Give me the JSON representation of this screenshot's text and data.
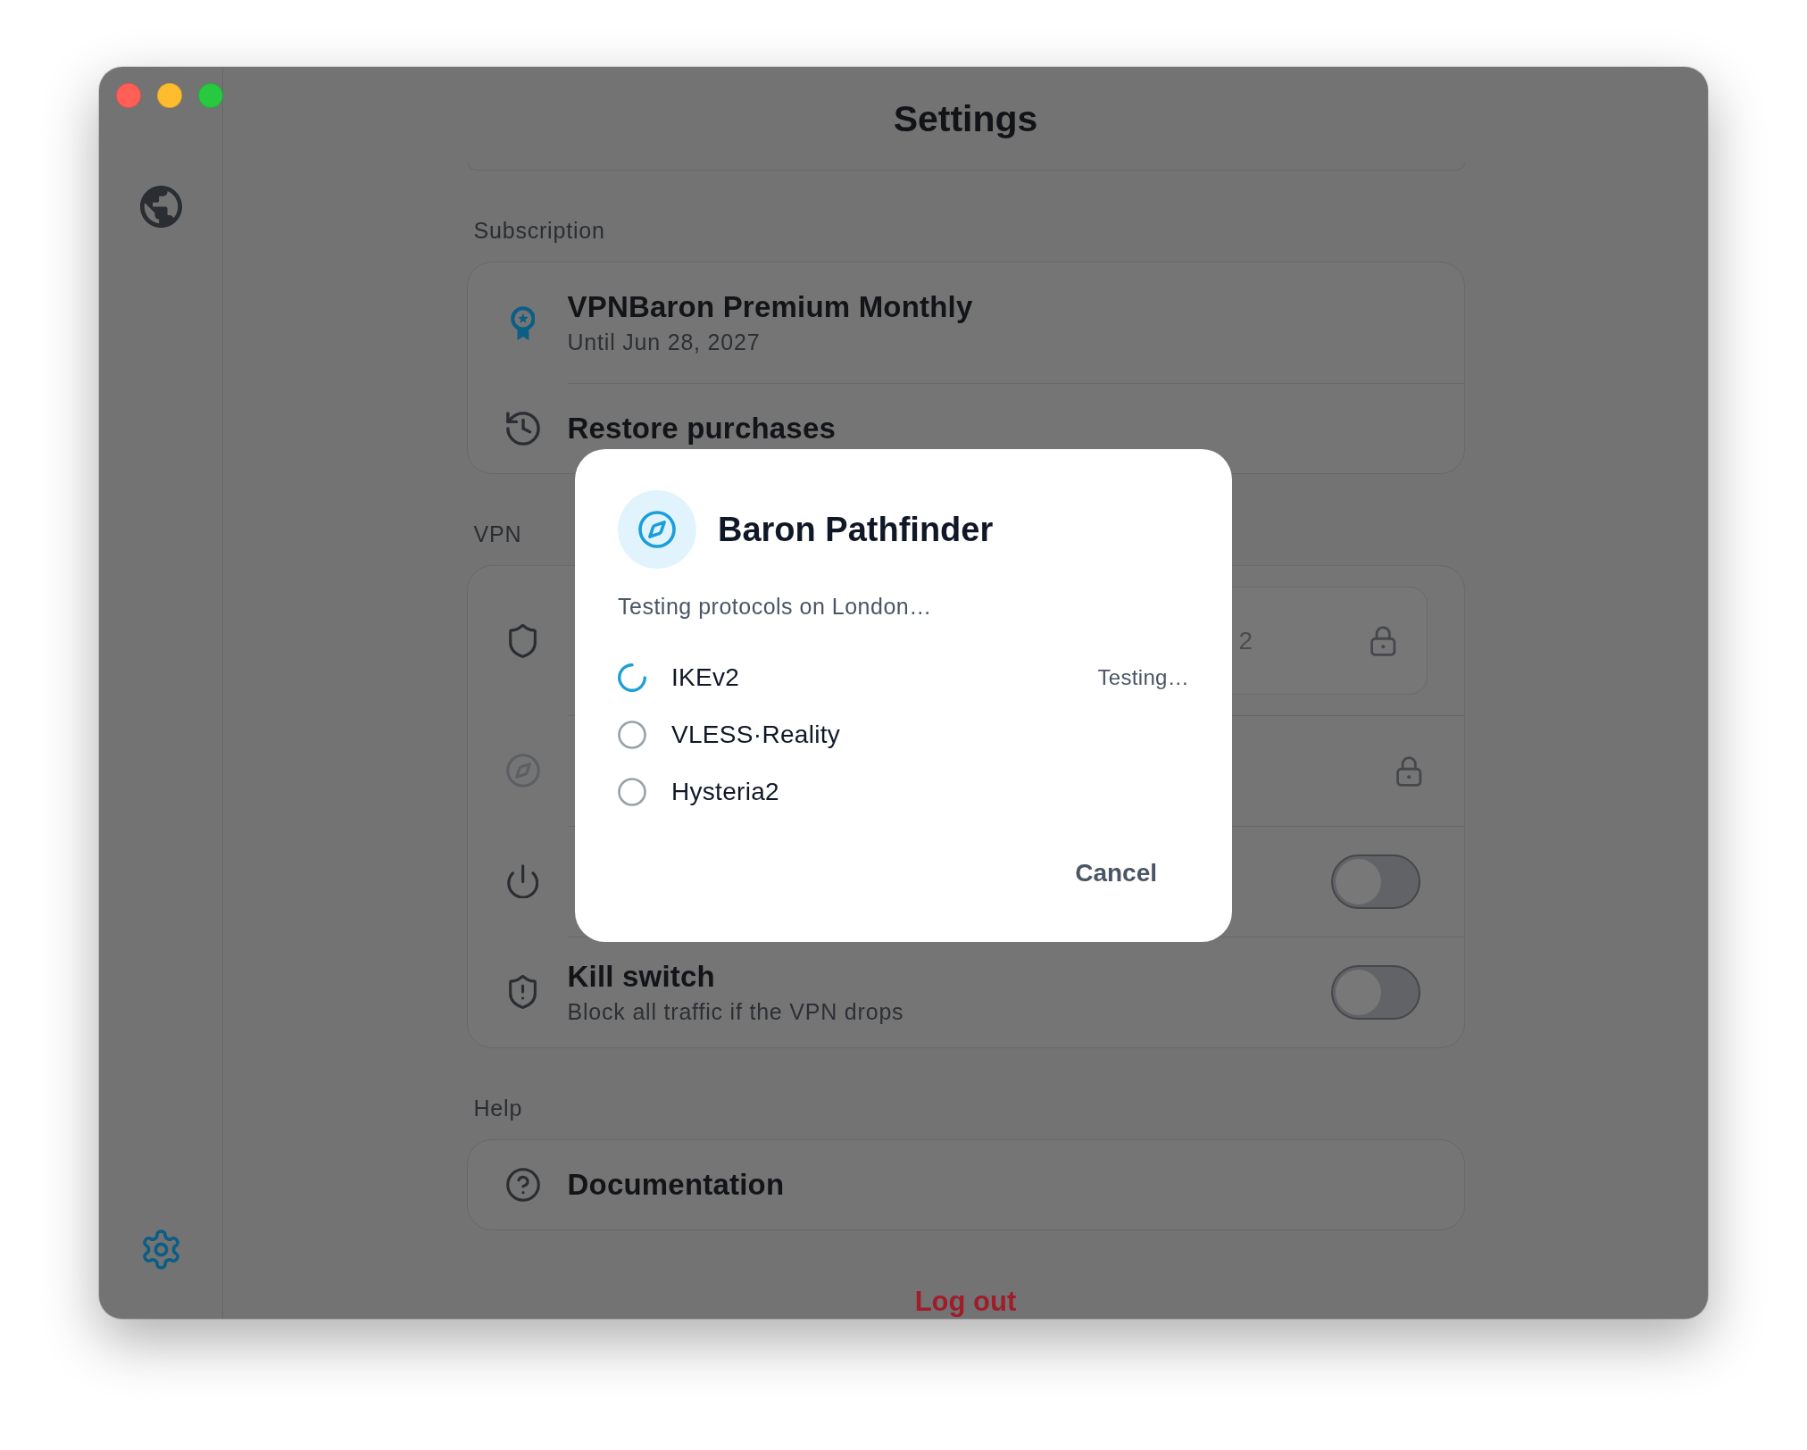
{
  "window": {
    "title": "Settings"
  },
  "sidebar": {
    "items": [
      {
        "selected": false
      },
      {
        "selected": true
      }
    ]
  },
  "sections": [
    {
      "label": "Subscription",
      "rows": [
        {
          "kind": "plan",
          "title": "VPNBaron Premium Monthly",
          "subtitle": "Until Jun 28, 2027"
        },
        {
          "kind": "action",
          "title": "Restore purchases"
        }
      ]
    },
    {
      "label": "VPN",
      "rows": [
        {
          "kind": "field",
          "disabled": false,
          "locked": true,
          "value": "2"
        },
        {
          "kind": "plain",
          "disabled": true,
          "locked": true
        },
        {
          "kind": "toggle",
          "disabled": false,
          "on": false
        },
        {
          "kind": "toggle",
          "disabled": false,
          "on": false,
          "title": "Kill switch",
          "subtitle": "Block all traffic if the VPN drops"
        }
      ]
    },
    {
      "label": "Help",
      "rows": [
        {
          "kind": "action",
          "title": "Documentation"
        }
      ]
    }
  ],
  "logout": {
    "label": "Log out"
  },
  "dialog": {
    "title": "Baron Pathfinder",
    "message": "Testing protocols on London…",
    "protocols": [
      {
        "name": "IKEv2",
        "testing": true,
        "status_text": "Testing…"
      },
      {
        "name": "VLESS·Reality",
        "testing": false
      },
      {
        "name": "Hysteria2",
        "testing": false
      }
    ],
    "cancel": "Cancel"
  }
}
